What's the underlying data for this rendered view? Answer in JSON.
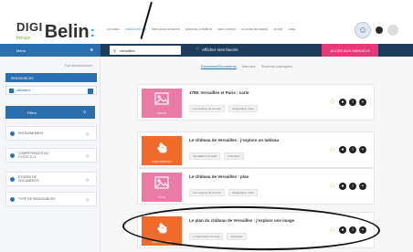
{
  "header": {
    "logo_top": "DIGI",
    "logo_sub": "thèque",
    "logo_main": "Belin",
    "logo_colon": ":",
    "nav": [
      "ACCUEIL",
      "RESSOURCES",
      "MES ÉDUCATEURS",
      "ESPACE COMMUN",
      "MES LISTES",
      "CLASSE DE DEMO",
      "AVOIR",
      "AIDE"
    ],
    "active_nav_index": 1
  },
  "toolbar": {
    "menu_label": "Menu",
    "close_label": "✖",
    "search_value": "versailles",
    "mid_label": "Afficher mes favoris",
    "pink_button": "ACCÈS AUX MANUELS"
  },
  "sidebar": {
    "head": "Tout déselectionner",
    "group_title": "RESSOURCES",
    "check_label": "Utilisateur",
    "filter_button": "Filtrer",
    "filters": [
      {
        "label": "ENTRAÎNEMENT"
      },
      {
        "label": "COMPÉTENCES DU CYCLE 3 / 4"
      },
      {
        "label": "ÉTUDES DE DOCUMENTS"
      },
      {
        "label": "TYPE DE RESSOURCES"
      }
    ],
    "filter_q": "Q"
  },
  "main": {
    "tabs": [
      "Exercices/Documents",
      "Manuels",
      "Séances partagées"
    ],
    "active_tab_index": 0,
    "cards": [
      {
        "title": "1789. Versailles et Paris : carte",
        "thumb": "pink",
        "cap": "CARTE",
        "tags": [
          "Les origines de la révol",
          "Géographie, carte"
        ]
      },
      {
        "title": "Le château de Versailles : j'explore un tableau",
        "thumb": "orange",
        "cap": "EXPLORATION",
        "tags": [
          "Versailles à la veille",
          "Animation"
        ]
      },
      {
        "title": "Le château de Versailles : plan",
        "thumb": "pink",
        "cap": "PLAN",
        "tags": [
          "Les origines de la révol",
          "Géographie, carte"
        ]
      },
      {
        "title": "Le plan du château de Versailles : j'explore une image",
        "thumb": "orange",
        "cap": "EXPLORATION",
        "tags": [
          "L'organisation du roya",
          "Animation"
        ]
      }
    ]
  },
  "colors": {
    "blue": "#2c6fae",
    "navy": "#1e3d5c",
    "pink": "#e5397a",
    "orange": "#ef6a2b"
  }
}
